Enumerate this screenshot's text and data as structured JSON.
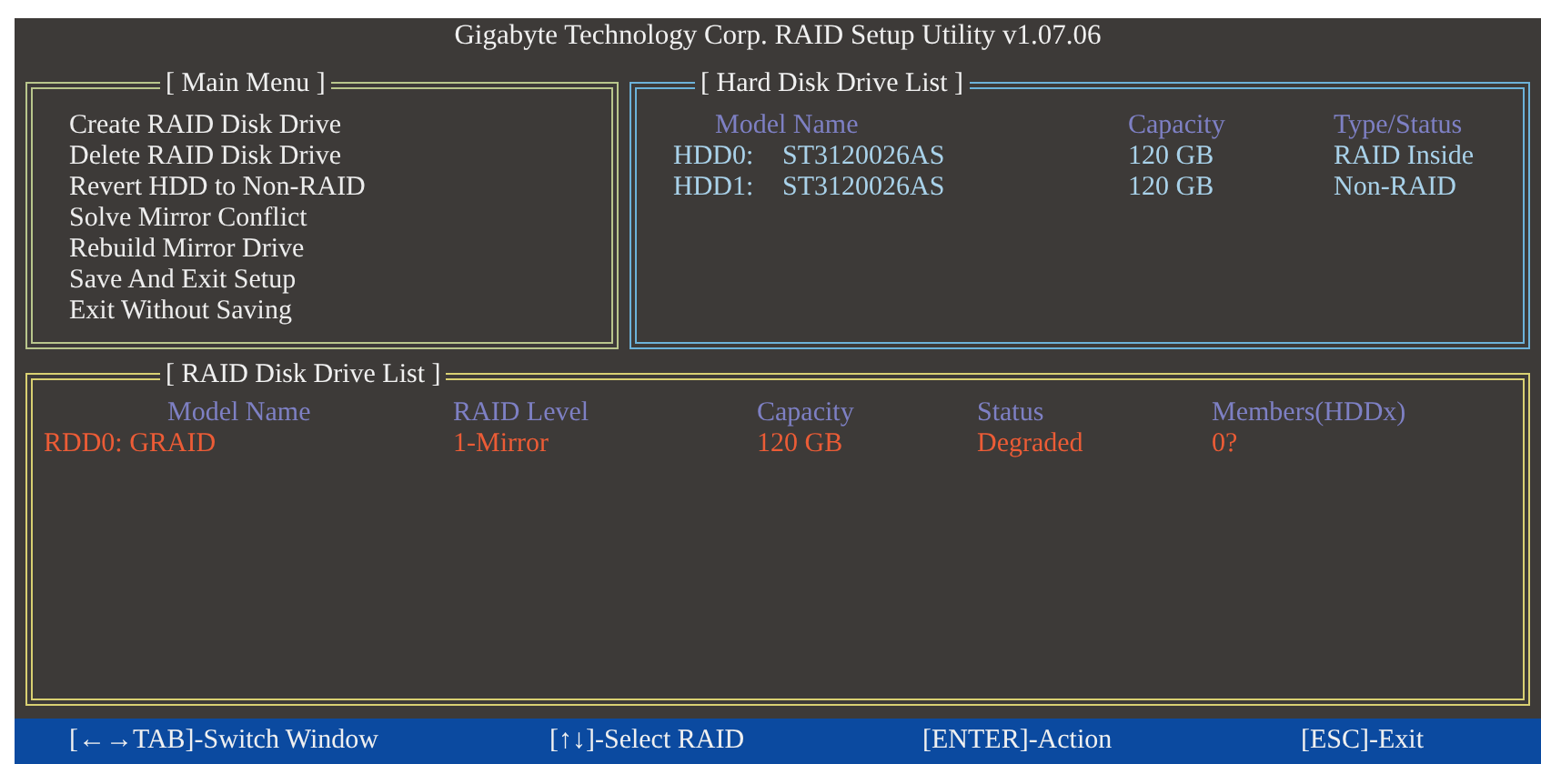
{
  "window": {
    "title": "Gigabyte Technology Corp.  RAID Setup Utility  v1.07.06"
  },
  "main_menu": {
    "title": "[ Main Menu ]",
    "items": [
      "Create RAID Disk Drive",
      "Delete RAID Disk Drive",
      "Revert HDD to Non-RAID",
      "Solve Mirror Conflict",
      "Rebuild Mirror Drive",
      "Save And Exit Setup",
      "Exit Without Saving"
    ]
  },
  "hdd_list": {
    "title": "[ Hard Disk Drive List ]",
    "columns": [
      "Model Name",
      "Capacity",
      "Type/Status"
    ],
    "rows": [
      {
        "port": "HDD0:",
        "model": "ST3120026AS",
        "capacity": "120 GB",
        "type_status": "RAID Inside"
      },
      {
        "port": "HDD1:",
        "model": "ST3120026AS",
        "capacity": "120 GB",
        "type_status": "Non-RAID"
      }
    ]
  },
  "raid_list": {
    "title": "[ RAID Disk Drive List ]",
    "columns": [
      "Model Name",
      "RAID Level",
      "Capacity",
      "Status",
      "Members(HDDx)"
    ],
    "rows": [
      {
        "model": "RDD0: GRAID",
        "raid_level": "1-Mirror",
        "capacity": "120 GB",
        "status": "Degraded",
        "members": "0?"
      }
    ]
  },
  "status_bar": [
    "[←→TAB]-Switch Window",
    "[↑↓]-Select RAID",
    "[ENTER]-Action",
    "[ESC]-Exit"
  ]
}
